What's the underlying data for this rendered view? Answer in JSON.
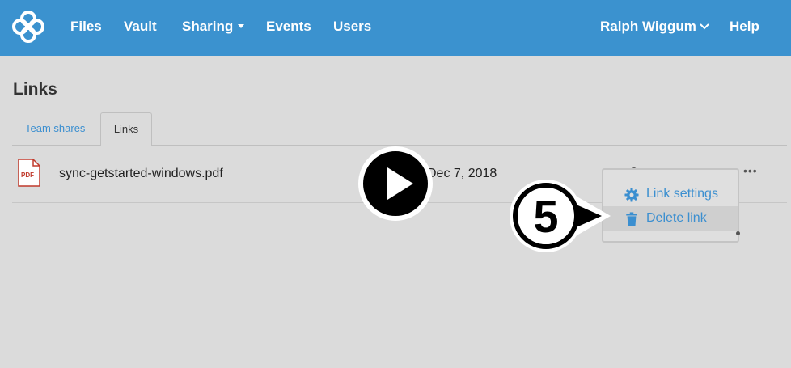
{
  "nav": {
    "items": [
      "Files",
      "Vault",
      "Sharing",
      "Events",
      "Users"
    ],
    "user": "Ralph Wiggum",
    "help": "Help"
  },
  "page": {
    "title": "Links"
  },
  "tabs": [
    {
      "label": "Team shares",
      "active": false
    },
    {
      "label": "Links",
      "active": true
    }
  ],
  "rows": [
    {
      "file_type": "PDF",
      "name": "sync-getstarted-windows.pdf",
      "date": "Dec 7, 2018"
    }
  ],
  "dropdown": {
    "items": [
      {
        "label": "Link settings",
        "icon": "gear-icon"
      },
      {
        "label": "Delete link",
        "icon": "trash-icon"
      }
    ]
  },
  "callout": {
    "step": "5"
  },
  "colors": {
    "brand": "#3b92cf",
    "link": "#3b8fd0",
    "background": "#dbdbdb",
    "pdf": "#c0392b"
  }
}
